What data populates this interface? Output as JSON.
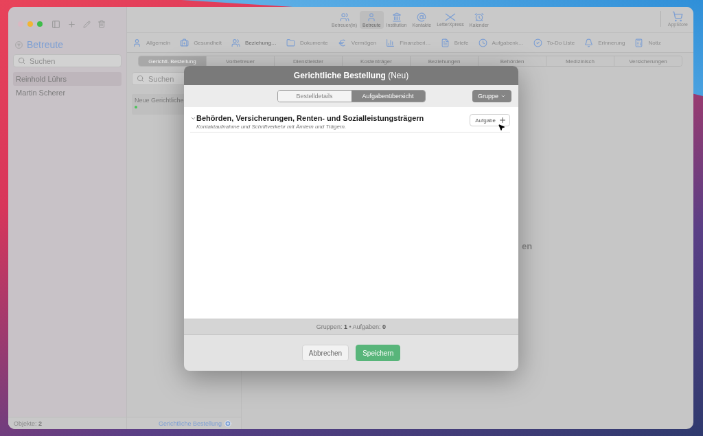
{
  "sidebar": {
    "title": "Betreute",
    "search": {
      "placeholder": "Suchen"
    },
    "items": [
      {
        "label": "Reinhold Lührs",
        "selected": true
      },
      {
        "label": "Martin Scherer",
        "selected": false
      }
    ],
    "footer": "Objekte: **2**"
  },
  "toolbar": {
    "modules": [
      {
        "label": "Betreuer(in)",
        "selected": false
      },
      {
        "label": "Betreute",
        "selected": true
      },
      {
        "label": "Institution",
        "selected": false
      },
      {
        "label": "Kontakte",
        "selected": false
      },
      {
        "label": "LetterXpress",
        "selected": false
      },
      {
        "label": "Kalender",
        "selected": false
      }
    ],
    "store": "AppStore"
  },
  "categories": [
    {
      "label": "Allgemein",
      "selected": false
    },
    {
      "label": "Gesundheit",
      "selected": false
    },
    {
      "label": "Beziehung…",
      "selected": true
    },
    {
      "label": "Dokumente",
      "selected": false
    },
    {
      "label": "Vermögen",
      "selected": false
    },
    {
      "label": "Finanzberi…",
      "selected": false
    },
    {
      "label": "Briefe",
      "selected": false
    },
    {
      "label": "Aufgabenk…",
      "selected": false
    },
    {
      "label": "To-Do Liste",
      "selected": false
    },
    {
      "label": "Erinnerung",
      "selected": false
    },
    {
      "label": "Notiz",
      "selected": false
    }
  ],
  "segments": [
    {
      "label": "Gerichtl. Bestellung",
      "selected": true
    },
    {
      "label": "Vorbetreuer",
      "selected": false
    },
    {
      "label": "Dienstleister",
      "selected": false
    },
    {
      "label": "Kostenträger",
      "selected": false
    },
    {
      "label": "Beziehungen",
      "selected": false
    },
    {
      "label": "Behörden",
      "selected": false
    },
    {
      "label": "Medizinisch",
      "selected": false
    },
    {
      "label": "Versicherungen",
      "selected": false
    }
  ],
  "list": {
    "search": {
      "placeholder": "Suchen"
    },
    "items": [
      {
        "label": "Neue Gerichtliche",
        "color": "#4cc35a"
      }
    ],
    "footer": "Gerichtliche Bestellung"
  },
  "detail": {
    "text": "en"
  },
  "modal": {
    "title": "Gerichtliche Bestellung",
    "title_suffix": "(Neu)",
    "tabs": [
      {
        "label": "Bestelldetails",
        "selected": false
      },
      {
        "label": "Aufgabenübersicht",
        "selected": true
      }
    ],
    "group_button": "Gruppe",
    "groups": [
      {
        "title": "Behörden, Versicherungen, Renten- und Sozialleistungsträgern",
        "subtitle": "Kontaktaufnahme und Schriftverkehr mit Ämtern und Trägern.",
        "expanded": true,
        "add_button": "Aufgabe"
      }
    ],
    "summary": "Gruppen: **1** • Aufgaben: **0**",
    "buttons": [
      {
        "label": "Abbrechen",
        "kind": "secondary"
      },
      {
        "label": "Speichern",
        "kind": "primary"
      }
    ]
  }
}
